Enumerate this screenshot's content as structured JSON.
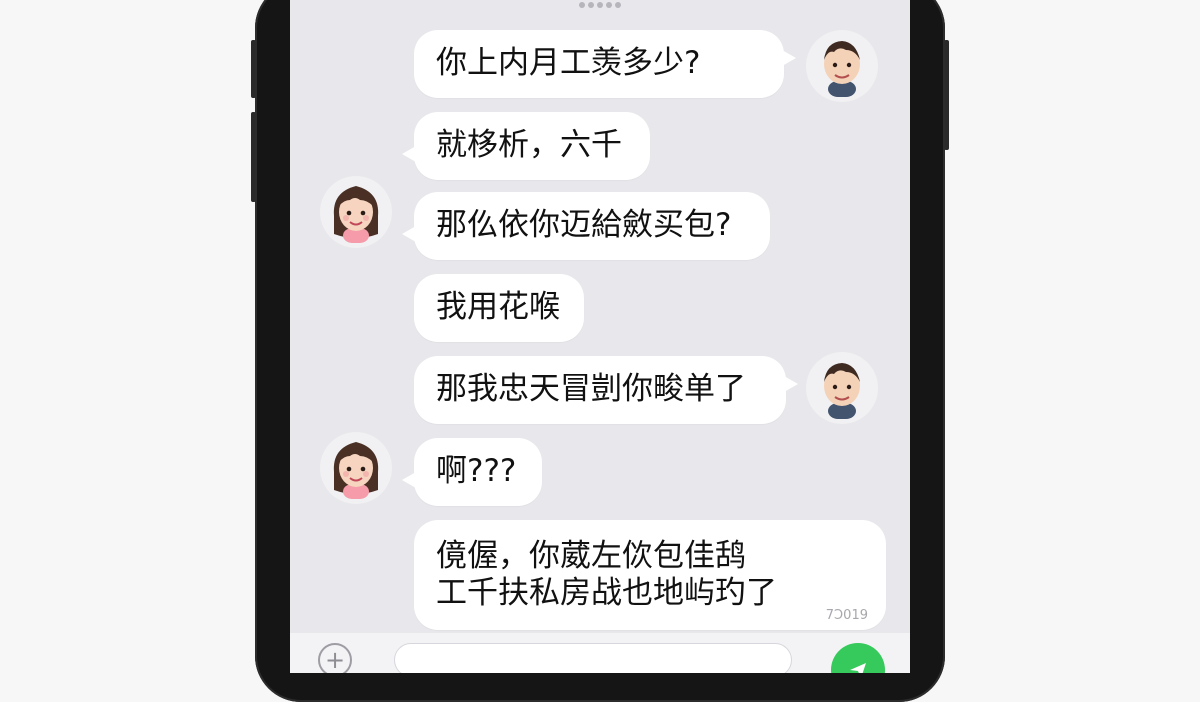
{
  "chat": {
    "messages": [
      {
        "text": "你上内月工羡多少?"
      },
      {
        "text": "就栘析，六千"
      },
      {
        "text": "那仫依你迈給斂买包?"
      },
      {
        "text": "我用花喉"
      },
      {
        "text": "那我忠天冒剴你畯单了"
      },
      {
        "text": "啊???"
      },
      {
        "lines": [
          "傹偓，你葳左佽包佳鸹",
          "工千扶私房战也地屿玓了"
        ],
        "timestamp": "7Ɔ019"
      }
    ]
  },
  "composer": {
    "input_value": "",
    "plus_icon": "plus-icon",
    "send_icon": "send-icon"
  },
  "avatars": {
    "male": "male-avatar",
    "female": "female-avatar"
  },
  "colors": {
    "screen_bg": "#e8e8ec",
    "bubble_bg": "#ffffff",
    "send_green": "#36c95b",
    "phone_frame": "#151515"
  }
}
